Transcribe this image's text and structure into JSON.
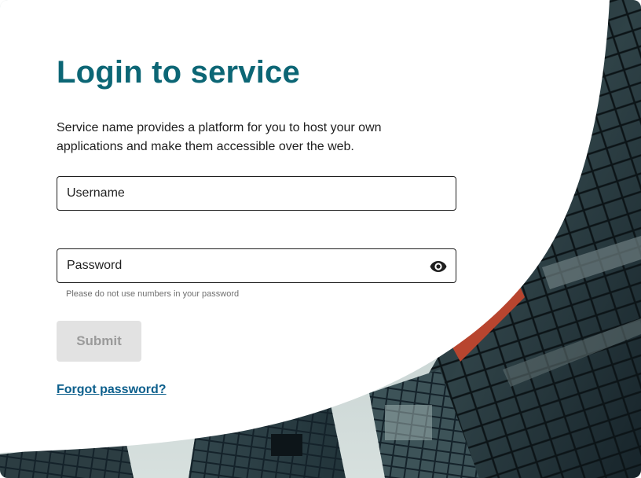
{
  "page": {
    "title": "Login to service",
    "intro": "Service name provides a platform for you to host your own applications and make them accessible over the web."
  },
  "form": {
    "username_placeholder": "Username",
    "username_value": "",
    "password_placeholder": "Password",
    "password_value": "",
    "password_hint": "Please do not use numbers in your password",
    "show_password_icon": "eye-icon",
    "submit_label": "Submit",
    "submit_disabled": true,
    "forgot_label": "Forgot password?"
  },
  "colors": {
    "title": "#0c6675",
    "link": "#0c5f8c",
    "submit_disabled_bg": "#e2e2e2",
    "submit_disabled_text": "#9a9a9a",
    "field_border": "#1f1f1f"
  }
}
